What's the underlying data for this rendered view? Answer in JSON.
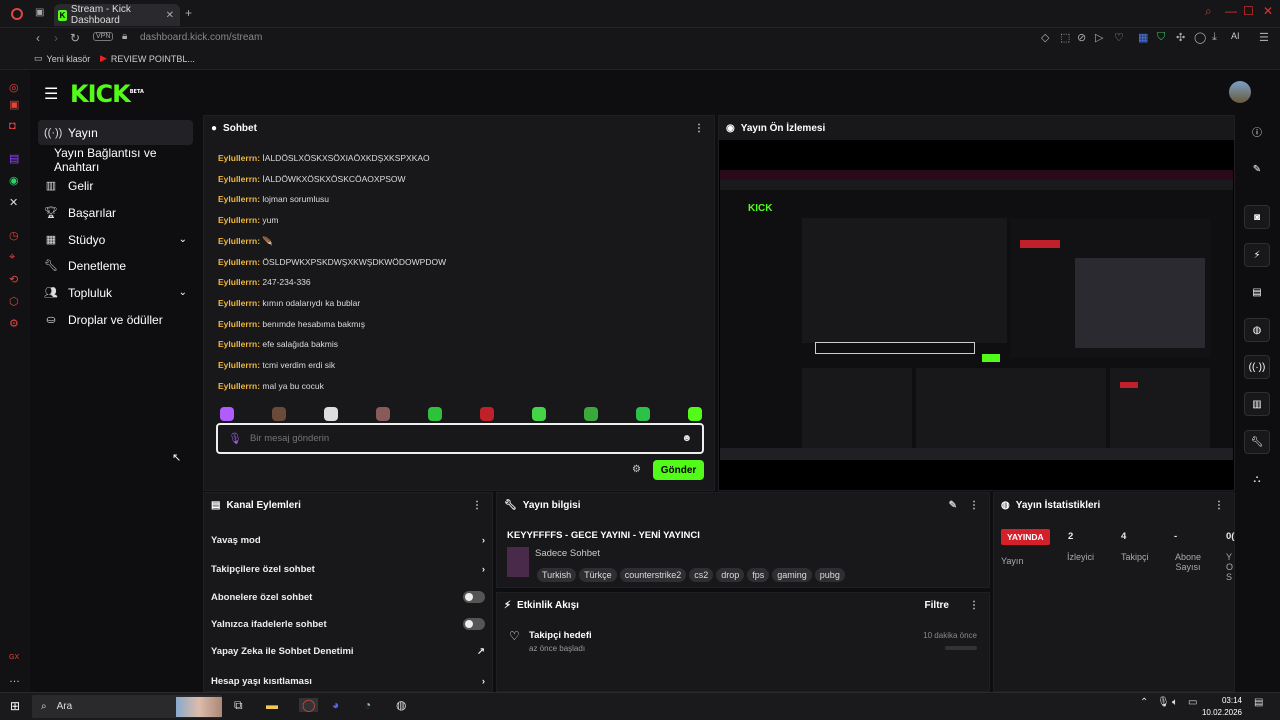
{
  "browser": {
    "tab_title": "Stream - Kick Dashboard",
    "address": "dashboard.kick.com/stream",
    "vpn": "VPN",
    "bookmarks": [
      "Yeni klasör",
      "REVIEW POINTBL..."
    ],
    "ai_label": "AI"
  },
  "sidebar": {
    "items": [
      {
        "label": "Yayın",
        "icon": "broadcast-icon"
      },
      {
        "label": "Yayın Bağlantısı ve Anahtarı",
        "icon": ""
      },
      {
        "label": "Gelir",
        "icon": "chart-icon"
      },
      {
        "label": "Başarılar",
        "icon": "trophy-icon"
      },
      {
        "label": "Stüdyo",
        "icon": "studio-icon"
      },
      {
        "label": "Denetleme",
        "icon": "wrench-icon"
      },
      {
        "label": "Topluluk",
        "icon": "people-icon"
      },
      {
        "label": "Droplar ve ödüller",
        "icon": "gift-icon"
      }
    ]
  },
  "chat": {
    "title": "Sohbet",
    "messages": [
      {
        "user": "Eylullerrn:",
        "text": "İALDÖSLXÖSKXSÖXIAÖXKDŞXKSPXKAO"
      },
      {
        "user": "Eylullerrn:",
        "text": "İALDÖWKXÖSKXÖSKCÖAOXPSOW"
      },
      {
        "user": "Eylullerrn:",
        "text": "lojman sorumlusu"
      },
      {
        "user": "Eylullerrn:",
        "text": "yum"
      },
      {
        "user": "Eylullerrn:",
        "text": "🪶"
      },
      {
        "user": "Eylullerrn:",
        "text": "ÖSLDPWKXPSKDWŞXKWŞDKWÖDOWPDOW"
      },
      {
        "user": "Eylullerrn:",
        "text": "247-234-336"
      },
      {
        "user": "Eylullerrn:",
        "text": "kımın odalarıydı ka bublar"
      },
      {
        "user": "Eylullerrn:",
        "text": "benımde hesabıma bakmış"
      },
      {
        "user": "Eylullerrn:",
        "text": "efe salağıda bakmis"
      },
      {
        "user": "Eylullerrn:",
        "text": "tcmi verdim erdi sik"
      },
      {
        "user": "Eylullerrn:",
        "text": "mal ya bu cocuk"
      }
    ],
    "input_placeholder": "Bir mesaj gönderin",
    "send_label": "Gönder"
  },
  "preview": {
    "title": "Yayın Ön İzlemesi"
  },
  "actions": {
    "title": "Kanal Eylemleri",
    "items": [
      {
        "label": "Yavaş mod",
        "control": "chevron"
      },
      {
        "label": "Takipçilere özel sohbet",
        "control": "chevron"
      },
      {
        "label": "Abonelere özel sohbet",
        "control": "toggle"
      },
      {
        "label": "Yalnızca ifadelerle sohbet",
        "control": "toggle"
      },
      {
        "label": "Yapay Zeka ile Sohbet Denetimi",
        "control": "link"
      },
      {
        "label": "Hesap yaşı kısıtlaması",
        "control": "chevron"
      }
    ]
  },
  "info": {
    "title": "Yayın bilgisi",
    "stream_title": "KEYYFFFFS - GECE YAYINI - YENİ YAYINCI",
    "category": "Sadece Sohbet",
    "tags": [
      "Turkish",
      "Türkçe",
      "counterstrike2",
      "cs2",
      "drop",
      "fps",
      "gaming",
      "pubg"
    ]
  },
  "activity": {
    "title": "Etkinlik Akışı",
    "filter_label": "Filtre",
    "item_title": "Takipçi hedefi",
    "item_sub": "az önce başladı",
    "item_time": "10 dakika önce"
  },
  "stats": {
    "title": "Yayın İstatistikleri",
    "live_badge": "YAYINDA",
    "cols": [
      {
        "value": "",
        "label": "Yayın"
      },
      {
        "value": "2",
        "label": "İzleyici"
      },
      {
        "value": "4",
        "label": "Takipçi"
      },
      {
        "value": "-",
        "label": "Abone Sayısı"
      },
      {
        "value": "0(",
        "label": "Y O S"
      }
    ]
  },
  "taskbar": {
    "search_label": "Ara",
    "time": "03:14",
    "date": "10.02.2026"
  },
  "colors": {
    "accent": "#53fc18",
    "live": "#d4202a",
    "username": "#f0b73a"
  }
}
